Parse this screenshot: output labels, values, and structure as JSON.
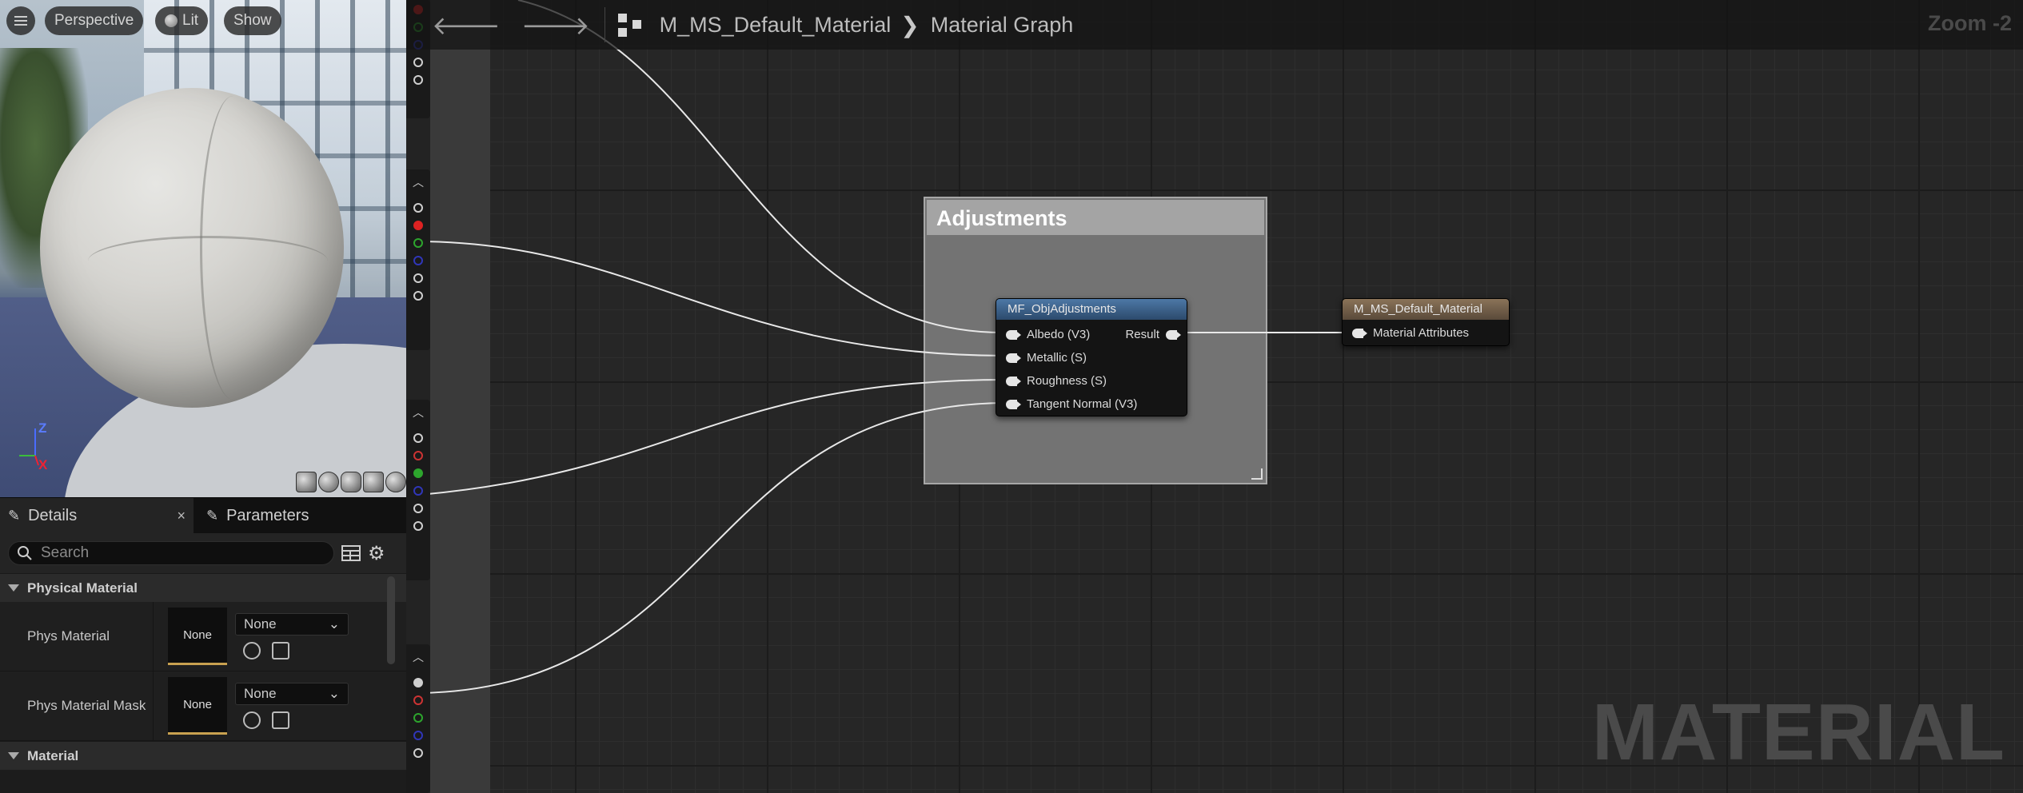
{
  "viewport": {
    "perspective_label": "Perspective",
    "lit_label": "Lit",
    "show_label": "Show",
    "axis_z": "Z",
    "axis_x": "X"
  },
  "details": {
    "tab_details": "Details",
    "tab_parameters": "Parameters",
    "close_glyph": "×",
    "search_placeholder": "Search",
    "section_physical": "Physical Material",
    "phys_material_label": "Phys Material",
    "phys_material_thumb": "None",
    "phys_material_value": "None",
    "phys_mask_label": "Phys Material Mask",
    "phys_mask_thumb": "None",
    "phys_mask_value": "None",
    "section_material": "Material"
  },
  "graph": {
    "back_glyph": "🡐",
    "forward_glyph": "🡒",
    "breadcrumb_asset": "M_MS_Default_Material",
    "breadcrumb_sep": "❯",
    "breadcrumb_graph": "Material Graph",
    "zoom": "Zoom -2",
    "watermark": "MATERIAL",
    "comment_title": "Adjustments",
    "function_node": {
      "title": "MF_ObjAdjustments",
      "inputs": [
        "Albedo (V3)",
        "Metallic (S)",
        "Roughness (S)",
        "Tangent Normal (V3)"
      ],
      "output": "Result"
    },
    "result_node": {
      "title": "M_MS_Default_Material",
      "input": "Material Attributes"
    }
  },
  "colors": {
    "function_head": "#3b5f86",
    "result_head": "#6b5a47",
    "pin_red": "#cc3333",
    "pin_green": "#2da52d",
    "pin_blue": "#3036b8"
  }
}
